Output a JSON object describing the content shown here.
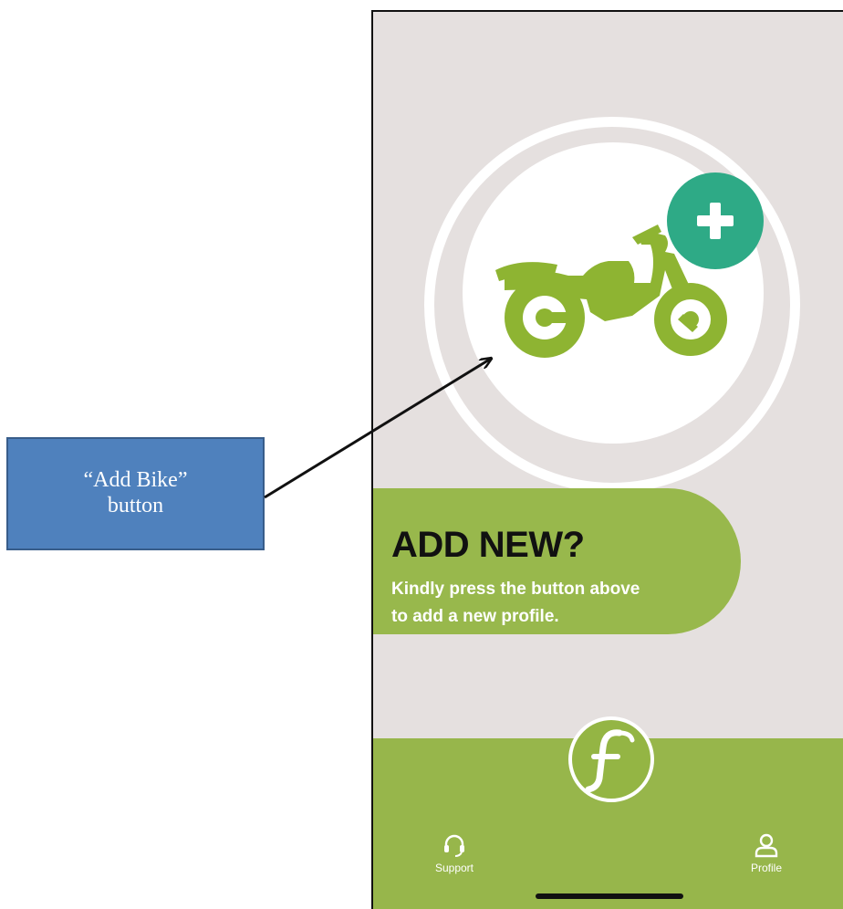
{
  "colors": {
    "background": "#e5e0df",
    "brand_green": "#97b64b",
    "bike_green": "#8eb432",
    "plus_teal": "#2eaa86",
    "callout_blue": "#4f81bd"
  },
  "main": {
    "add_bike_icon": "motorcycle-icon",
    "plus_icon": "plus-icon"
  },
  "promo": {
    "title": "ADD NEW?",
    "line1": "Kindly press the button above",
    "line2": "to add a new profile."
  },
  "tabbar": {
    "support_label": "Support",
    "profile_label": "Profile",
    "center_icon": "brand-f-logo-icon"
  },
  "annotation": {
    "line1": "“Add Bike”",
    "line2": "button"
  }
}
